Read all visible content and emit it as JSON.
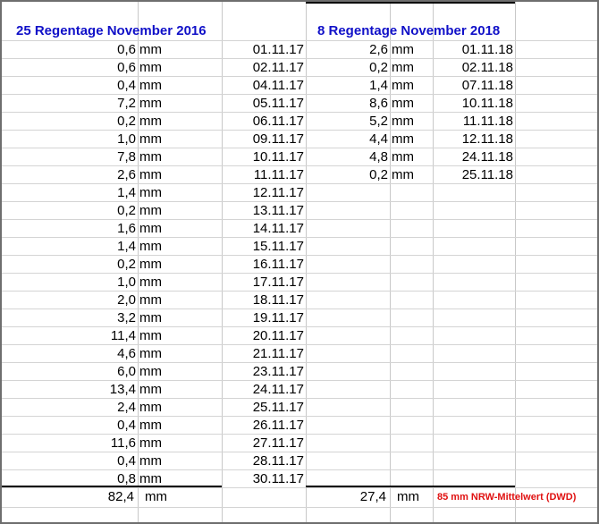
{
  "colors": {
    "header": "#1010c8",
    "note": "#e01010",
    "grid": "#c8c8c8"
  },
  "sheet": {
    "left": {
      "title": "25 Regentage November 2016",
      "rows": [
        {
          "value": "0,6",
          "unit": "mm",
          "date": "01.11.17"
        },
        {
          "value": "0,6",
          "unit": "mm",
          "date": "02.11.17"
        },
        {
          "value": "0,4",
          "unit": "mm",
          "date": "04.11.17"
        },
        {
          "value": "7,2",
          "unit": "mm",
          "date": "05.11.17"
        },
        {
          "value": "0,2",
          "unit": "mm",
          "date": "06.11.17"
        },
        {
          "value": "1,0",
          "unit": "mm",
          "date": "09.11.17"
        },
        {
          "value": "7,8",
          "unit": "mm",
          "date": "10.11.17"
        },
        {
          "value": "2,6",
          "unit": "mm",
          "date": "11.11.17"
        },
        {
          "value": "1,4",
          "unit": "mm",
          "date": "12.11.17"
        },
        {
          "value": "0,2",
          "unit": "mm",
          "date": "13.11.17"
        },
        {
          "value": "1,6",
          "unit": "mm",
          "date": "14.11.17"
        },
        {
          "value": "1,4",
          "unit": "mm",
          "date": "15.11.17"
        },
        {
          "value": "0,2",
          "unit": "mm",
          "date": "16.11.17"
        },
        {
          "value": "1,0",
          "unit": "mm",
          "date": "17.11.17"
        },
        {
          "value": "2,0",
          "unit": "mm",
          "date": "18.11.17"
        },
        {
          "value": "3,2",
          "unit": "mm",
          "date": "19.11.17"
        },
        {
          "value": "11,4",
          "unit": "mm",
          "date": "20.11.17"
        },
        {
          "value": "4,6",
          "unit": "mm",
          "date": "21.11.17"
        },
        {
          "value": "6,0",
          "unit": "mm",
          "date": "23.11.17"
        },
        {
          "value": "13,4",
          "unit": "mm",
          "date": "24.11.17"
        },
        {
          "value": "2,4",
          "unit": "mm",
          "date": "25.11.17"
        },
        {
          "value": "0,4",
          "unit": "mm",
          "date": "26.11.17"
        },
        {
          "value": "11,6",
          "unit": "mm",
          "date": "27.11.17"
        },
        {
          "value": "0,4",
          "unit": "mm",
          "date": "28.11.17"
        },
        {
          "value": "0,8",
          "unit": "mm",
          "date": "30.11.17"
        }
      ],
      "total": {
        "value": "82,4",
        "unit": "mm"
      }
    },
    "right": {
      "title": "8 Regentage November 2018",
      "rows": [
        {
          "value": "2,6",
          "unit": "mm",
          "date": "01.11.18"
        },
        {
          "value": "0,2",
          "unit": "mm",
          "date": "02.11.18"
        },
        {
          "value": "1,4",
          "unit": "mm",
          "date": "07.11.18"
        },
        {
          "value": "8,6",
          "unit": "mm",
          "date": "10.11.18"
        },
        {
          "value": "5,2",
          "unit": "mm",
          "date": "11.11.18"
        },
        {
          "value": "4,4",
          "unit": "mm",
          "date": "12.11.18"
        },
        {
          "value": "4,8",
          "unit": "mm",
          "date": "24.11.18"
        },
        {
          "value": "0,2",
          "unit": "mm",
          "date": "25.11.18"
        }
      ],
      "total": {
        "value": "27,4",
        "unit": "mm"
      },
      "note": "85 mm NRW-Mittelwert (DWD)"
    }
  }
}
